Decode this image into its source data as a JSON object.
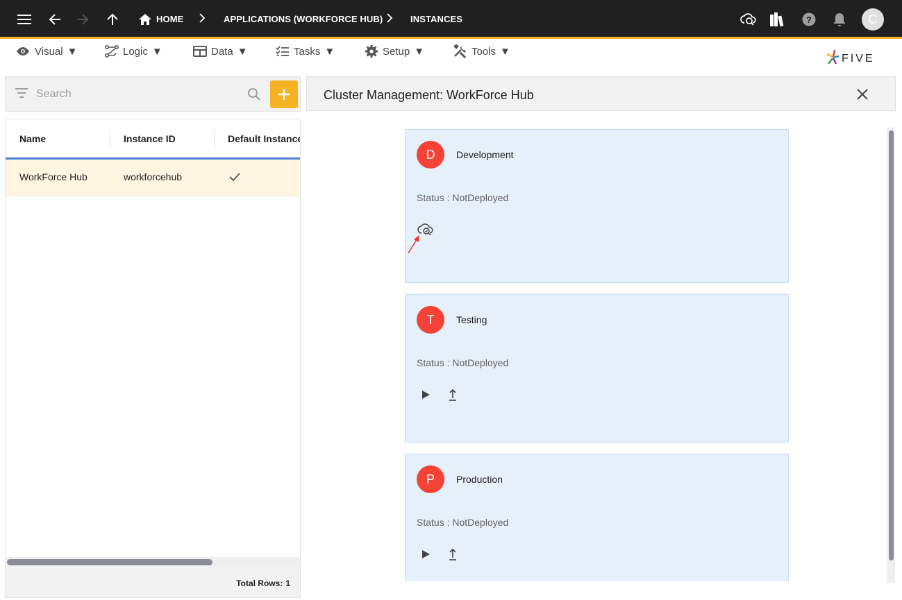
{
  "topbar": {
    "breadcrumbs": [
      "HOME",
      "APPLICATIONS (WORKFORCE HUB)",
      "INSTANCES"
    ],
    "avatar_initial": "C",
    "accent_color": "#f5b324",
    "icons": [
      "menu-icon",
      "back-arrow-icon",
      "forward-arrow-icon",
      "up-arrow-icon",
      "home-icon",
      "cloud-deploy-icon",
      "library-icon",
      "help-icon",
      "bell-icon"
    ]
  },
  "menubar": {
    "items": [
      {
        "label": "Visual",
        "icon": "eye-icon"
      },
      {
        "label": "Logic",
        "icon": "logic-icon"
      },
      {
        "label": "Data",
        "icon": "table-icon"
      },
      {
        "label": "Tasks",
        "icon": "tasks-icon"
      },
      {
        "label": "Setup",
        "icon": "gear-icon"
      },
      {
        "label": "Tools",
        "icon": "tools-icon"
      }
    ],
    "logo_text": "FIVE"
  },
  "left": {
    "search_placeholder": "Search",
    "columns": [
      "Name",
      "Instance ID",
      "Default Instance"
    ],
    "rows": [
      {
        "name": "WorkForce Hub",
        "instance_id": "workforcehub",
        "default": true
      }
    ],
    "total_rows_label": "Total Rows:",
    "total_rows_value": "1"
  },
  "right": {
    "title": "Cluster Management: WorkForce Hub",
    "environments": [
      {
        "initial": "D",
        "name": "Development",
        "status": "Status : NotDeployed",
        "actions": [
          "cloud-deploy-icon"
        ]
      },
      {
        "initial": "T",
        "name": "Testing",
        "status": "Status : NotDeployed",
        "actions": [
          "play-icon",
          "upload-icon"
        ]
      },
      {
        "initial": "P",
        "name": "Production",
        "status": "Status : NotDeployed",
        "actions": [
          "play-icon",
          "upload-icon"
        ]
      }
    ],
    "avatar_color": "#f44336"
  }
}
